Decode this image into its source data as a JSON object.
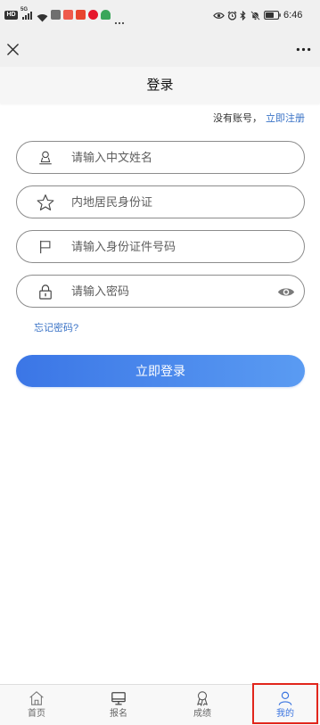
{
  "status_bar": {
    "network": "HD",
    "signal": "5G",
    "time": "6:46",
    "left_icons": [
      "hd-icon",
      "signal-icon",
      "wifi-icon",
      "app-notification-icon",
      "more-notifications-icon"
    ],
    "right_icons": [
      "eye-icon",
      "alarm-icon",
      "bluetooth-icon",
      "mute-bell-icon",
      "battery-icon"
    ]
  },
  "browser_bar": {
    "close_icon": "close-icon",
    "more_icon": "more-dots-icon"
  },
  "header": {
    "title": "登录"
  },
  "register_prompt": {
    "text": "没有账号，",
    "link": "立即注册"
  },
  "form": {
    "name": {
      "placeholder": "请输入中文姓名",
      "icon": "person-icon"
    },
    "id_type": {
      "value": "内地居民身份证",
      "icon": "star-icon"
    },
    "id_number": {
      "placeholder": "请输入身份证件号码",
      "icon": "flag-icon"
    },
    "password": {
      "placeholder": "请输入密码",
      "icon": "lock-icon",
      "toggle_icon": "eye-icon"
    }
  },
  "forgot_password": "忘记密码?",
  "login_button": "立即登录",
  "tabbar": {
    "items": [
      {
        "label": "首页",
        "icon": "home-icon",
        "active": false
      },
      {
        "label": "报名",
        "icon": "monitor-icon",
        "active": false
      },
      {
        "label": "成绩",
        "icon": "award-icon",
        "active": false
      },
      {
        "label": "我的",
        "icon": "user-icon",
        "active": true
      }
    ]
  },
  "colors": {
    "accent": "#3a74e0",
    "link": "#3a73c6",
    "button_start": "#3b76e6",
    "button_end": "#5a9bf2",
    "highlight": "#e1261c"
  }
}
